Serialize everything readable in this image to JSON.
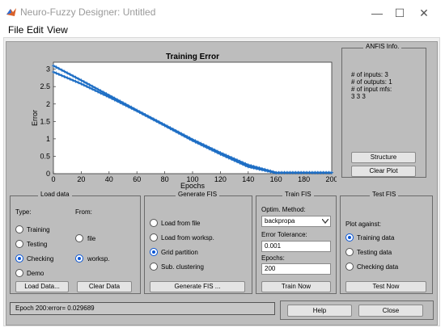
{
  "window": {
    "title": "Neuro-Fuzzy Designer: Untitled"
  },
  "window_controls": {
    "minimize": "—",
    "maximize": "☐",
    "close": "✕"
  },
  "menu": [
    "File",
    "Edit",
    "View"
  ],
  "chart_data": {
    "type": "line",
    "title": "Training Error",
    "xlabel": "Epochs",
    "ylabel": "Error",
    "xlim": [
      0,
      200
    ],
    "ylim": [
      0,
      3.2
    ],
    "xticks": [
      "0",
      "20",
      "40",
      "60",
      "80",
      "100",
      "120",
      "140",
      "160",
      "180",
      "200"
    ],
    "yticks": [
      "0",
      "0.5",
      "1",
      "1.5",
      "2",
      "2.5",
      "3"
    ],
    "series": [
      {
        "x": [
          0,
          20,
          40,
          60,
          80,
          100,
          120,
          140,
          160,
          165,
          170,
          180,
          190,
          200
        ],
        "y": [
          3.1,
          2.68,
          2.25,
          1.82,
          1.4,
          0.98,
          0.6,
          0.25,
          0.03,
          0.03,
          0.03,
          0.03,
          0.03,
          0.03
        ]
      },
      {
        "x": [
          0,
          20,
          40,
          60,
          80,
          100,
          120,
          140,
          160,
          165,
          170,
          180,
          190,
          200
        ],
        "y": [
          2.92,
          2.58,
          2.2,
          1.8,
          1.38,
          0.95,
          0.56,
          0.2,
          0.02,
          0.03,
          0.03,
          0.03,
          0.03,
          0.03
        ]
      }
    ],
    "line_color": "#1f6fc5",
    "grid": false
  },
  "anfis_info": {
    "title": "ANFIS Info.",
    "lines": [
      "# of inputs: 3",
      "# of outputs: 1",
      "# of input mfs:",
      "3  3  3"
    ],
    "structure_button": "Structure",
    "clear_plot_button": "Clear Plot"
  },
  "load_data": {
    "title": "Load data",
    "type_label": "Type:",
    "from_label": "From:",
    "type_options": [
      "Training",
      "Testing",
      "Checking",
      "Demo"
    ],
    "type_selected": "Checking",
    "from_options": [
      "file",
      "worksp."
    ],
    "from_selected": "worksp.",
    "load_button": "Load Data...",
    "clear_button": "Clear Data"
  },
  "generate_fis": {
    "title": "Generate FIS",
    "options": [
      "Load from file",
      "Load from worksp.",
      "Grid partition",
      "Sub. clustering"
    ],
    "selected": "Grid partition",
    "button": "Generate FIS ..."
  },
  "train_fis": {
    "title": "Train FIS",
    "optim_label": "Optim. Method:",
    "optim_value": "backpropa",
    "tolerance_label": "Error Tolerance:",
    "tolerance_value": "0.001",
    "epochs_label": "Epochs:",
    "epochs_value": "200",
    "button": "Train Now"
  },
  "test_fis": {
    "title": "Test FIS",
    "plot_against_label": "Plot against:",
    "options": [
      "Training data",
      "Testing data",
      "Checking data"
    ],
    "selected": "Training data",
    "button": "Test Now"
  },
  "status": {
    "text": "Epoch 200:error= 0.029689"
  },
  "help_button": "Help",
  "close_button": "Close"
}
